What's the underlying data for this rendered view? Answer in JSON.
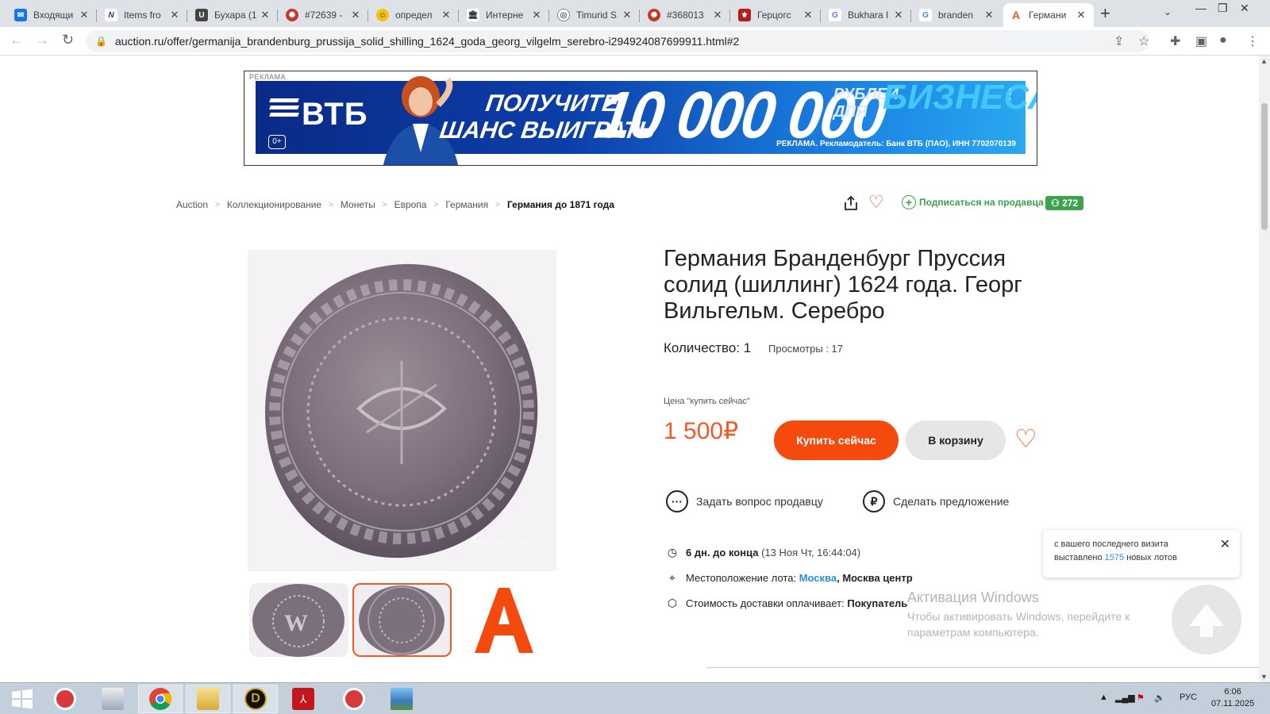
{
  "browser": {
    "tabs": [
      {
        "title": "Входящи",
        "favicon": "mail-icon",
        "color": "#1a73e8"
      },
      {
        "title": "Items fro",
        "favicon": "n-logo-icon",
        "color": "#1e3a8a"
      },
      {
        "title": "Бухара (1",
        "favicon": "u-logo-icon",
        "color": "#444444"
      },
      {
        "title": "#72639 -",
        "favicon": "coin-site-icon",
        "color": "#c0392b"
      },
      {
        "title": "определ",
        "favicon": "smile-icon",
        "color": "#d4a017"
      },
      {
        "title": "Интерне",
        "favicon": "archive-icon",
        "color": "#333333"
      },
      {
        "title": "Timurid S",
        "favicon": "globe-icon",
        "color": "#666666"
      },
      {
        "title": "#368013",
        "favicon": "coin-site-icon",
        "color": "#c0392b"
      },
      {
        "title": "Герцогс",
        "favicon": "heraldry-icon",
        "color": "#b71c1c"
      },
      {
        "title": "Bukhara I",
        "favicon": "google-icon",
        "color": "#4285f4"
      },
      {
        "title": "branden",
        "favicon": "google-icon",
        "color": "#4285f4"
      },
      {
        "title": "Германи",
        "favicon": "auction-a-icon",
        "color": "#f05a28"
      }
    ],
    "url": "auction.ru/offer/germanija_brandenburg_prussija_solid_shilling_1624_goda_georg_vilgelm_serebro-i294924087699911.html#2"
  },
  "ad": {
    "label": "РЕКЛАМА",
    "brand": "ВТБ",
    "age": "0+",
    "line1": "ПОЛУЧИТЕ",
    "line2": "ШАНС ВЫИГРАТЬ",
    "amount": "10 000 000",
    "small": "РУБЛЕЙ ДЛЯ",
    "biz": "БИЗНЕСА",
    "legal": "РЕКЛАМА. Рекламодатель: Банк ВТБ (ПАО), ИНН 7702070139"
  },
  "breadcrumbs": [
    "Auction",
    "Коллекционирование",
    "Монеты",
    "Европа",
    "Германия"
  ],
  "breadcrumb_current": "Германия до 1871 года",
  "subscribe": {
    "label": "Подписаться на продавца",
    "count": "272"
  },
  "product": {
    "title": "Германия Бранденбург Пруссия солид (шиллинг) 1624 года. Георг Вильгельм. Серебро",
    "quantity": "Количество: 1",
    "views": "Просмотры : 17",
    "price_label": "Цена \"купить сейчас\"",
    "price": "1 500₽",
    "buy_label": "Купить сейчас",
    "cart_label": "В корзину",
    "ask_label": "Задать вопрос продавцу",
    "offer_label": "Сделать предложение",
    "time_left": "6 дн. до конца",
    "end_date": "(13 Ноя Чт, 16:44:04)",
    "location_label": "Местоположение лота:",
    "location_city": "Москва",
    "location_region": ", Москва центр",
    "delivery_label": "Стоимость доставки оплачивает:",
    "delivery_payer": "Покупатель"
  },
  "toast": {
    "text1": "с вашего последнего визита",
    "text2": "выставлено",
    "count": "1575",
    "text3": "новых лотов"
  },
  "watermark": {
    "title": "Активация Windows",
    "text": "Чтобы активировать Windows, перейдите к параметрам компьютера."
  },
  "taskbar": {
    "lang": "РУС",
    "time": "6:06",
    "date": "07.11.2025"
  },
  "colors": {
    "accent": "#f05a28",
    "buy": "#f54a0e",
    "green": "#3aa34b",
    "link": "#2e8fd9"
  }
}
